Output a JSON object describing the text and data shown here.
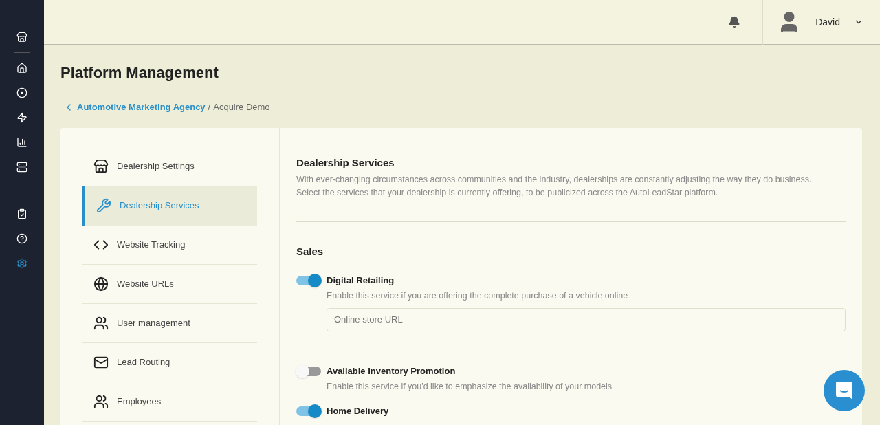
{
  "rail": [
    {
      "kind": "store",
      "selected": false
    },
    {
      "kind": "home",
      "selected": false
    },
    {
      "kind": "target",
      "selected": false
    },
    {
      "kind": "bolt",
      "selected": false
    },
    {
      "kind": "chart",
      "selected": false
    },
    {
      "kind": "list",
      "selected": false
    },
    {
      "kind": "clipboard",
      "selected": false
    },
    {
      "kind": "help",
      "selected": false
    },
    {
      "kind": "gear",
      "selected": true
    }
  ],
  "user": {
    "name": "David"
  },
  "page_title": "Platform Management",
  "breadcrumb": {
    "parent": "Automotive Marketing Agency",
    "separator": "/",
    "current": "Acquire Demo"
  },
  "menu": [
    {
      "kind": "store",
      "label": "Dealership Settings",
      "selected": false
    },
    {
      "kind": "wrench",
      "label": "Dealership Services",
      "selected": true
    },
    {
      "kind": "code",
      "label": "Website Tracking",
      "selected": false
    },
    {
      "kind": "globe",
      "label": "Website URLs",
      "selected": false
    },
    {
      "kind": "users",
      "label": "User management",
      "selected": false
    },
    {
      "kind": "mail",
      "label": "Lead Routing",
      "selected": false
    },
    {
      "kind": "users",
      "label": "Employees",
      "selected": false
    }
  ],
  "section": {
    "title": "Dealership Services",
    "description": "With ever-changing circumstances across communities and the industry, dealerships are constantly adjusting the way they do business. Select the services that your dealership is currently offering, to be publicized across the AutoLeadStar platform.",
    "group": "Sales",
    "services": [
      {
        "name": "Digital Retailing",
        "on": true,
        "hint": "Enable this service if you are offering the complete purchase of a vehicle online",
        "placeholder": "Online store URL"
      },
      {
        "name": "Available Inventory Promotion",
        "on": false,
        "hint": "Enable this service if you'd like to emphasize the availability of your models"
      },
      {
        "name": "Home Delivery",
        "on": true
      }
    ]
  }
}
